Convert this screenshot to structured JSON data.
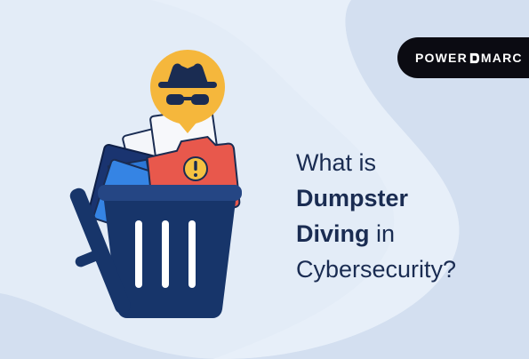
{
  "brand": {
    "logo_text": "POWERDMARC",
    "logo_left": "POWER",
    "logo_right": "MARC",
    "logo_bg": "#0b0b12",
    "logo_fg": "#ffffff"
  },
  "headline": {
    "line1": "What is",
    "line2": "Dumpster",
    "line3_bold": "Diving",
    "line3_rest": " in",
    "line4": "Cybersecurity?",
    "color": "#1a2c52"
  },
  "colors": {
    "background": "#e3ecf7",
    "blob": "#d2deef",
    "bin": "#17356a",
    "bin_rim": "#254684",
    "bin_stripe": "#ffffff",
    "folder_red": "#e8584c",
    "folder_blue": "#2c77d6",
    "folder_navy": "#1a3470",
    "paper": "#f4f6fa",
    "badge_orange": "#f5b73c",
    "warning": "#f5c242"
  },
  "icons": {
    "spy": "spy-incognito-icon",
    "warning": "warning-icon",
    "trash": "trash-bin-icon"
  }
}
